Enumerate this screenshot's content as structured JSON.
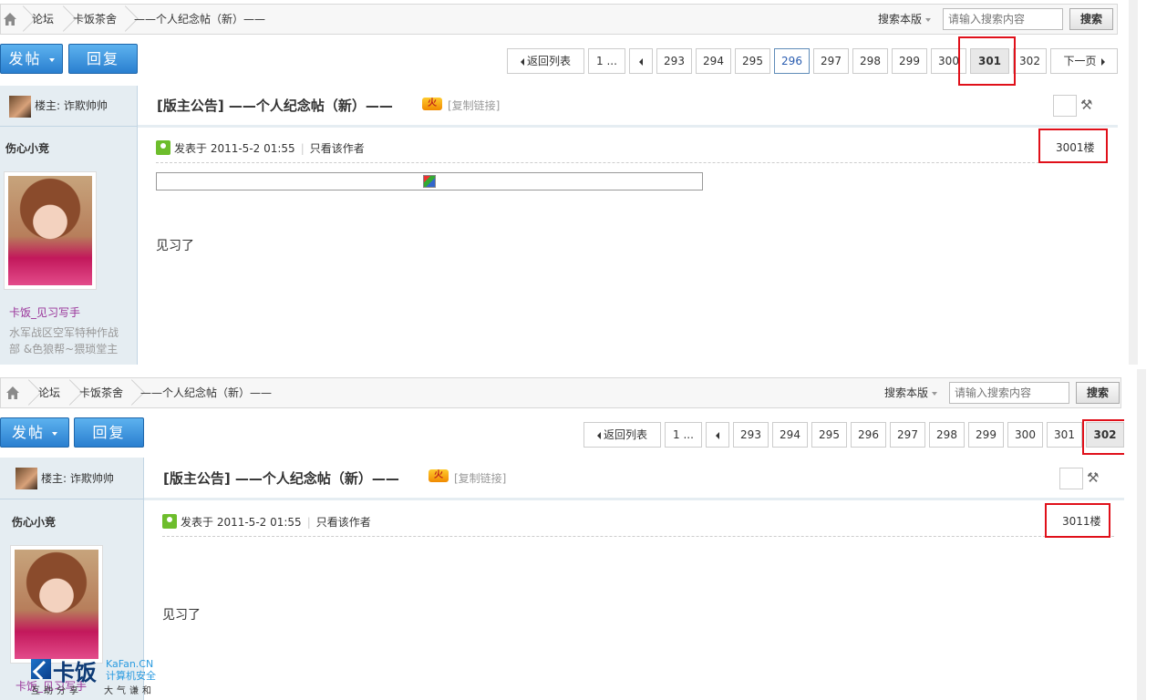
{
  "breadcrumb": {
    "forum": "论坛",
    "board": "卡饭茶舍",
    "thread": "——个人纪念帖（新）——"
  },
  "search": {
    "scope_label": "搜索本版",
    "placeholder": "请输入搜索内容",
    "button_label": "搜索"
  },
  "actions": {
    "new_post": "发帖",
    "reply": "回复"
  },
  "pagination_top": {
    "back": "返回列表",
    "first": "1 ...",
    "pages": [
      "293",
      "294",
      "295",
      "296",
      "297",
      "298",
      "299",
      "300",
      "301",
      "302"
    ],
    "next": "下一页",
    "current": "301"
  },
  "pagination_bottom": {
    "back": "返回列表",
    "first": "1 ...",
    "pages": [
      "293",
      "294",
      "295",
      "296",
      "297",
      "298",
      "299",
      "300",
      "301",
      "302"
    ],
    "current": "302"
  },
  "thread": {
    "author_label": "楼主: 诈欺帅帅",
    "title": "[版主公告] ——个人纪念帖（新）——",
    "fire_badge": "火",
    "copy_link": "[复制链接]"
  },
  "post1": {
    "username": "伤心小竞",
    "rank": "卡饭_见习写手",
    "medal_line1": "水军战区空军特种作战",
    "medal_line2": "部 &色狼帮~猥琐堂主",
    "posted": "发表于 2011-5-2 01:55",
    "only_author": "只看该作者",
    "floor": "3001楼",
    "content": "见习了"
  },
  "post2": {
    "username": "伤心小竞",
    "rank": "卡饭_见习写手",
    "posted": "发表于 2011-5-2 01:55",
    "only_author": "只看该作者",
    "floor": "3011楼",
    "content": "见习了"
  },
  "watermark": {
    "brand": "卡饭",
    "site": "KaFan.CN",
    "subtitle": "计算机安全",
    "slogan_left": "互助分享",
    "slogan_right": "大气谦和"
  },
  "colors": {
    "accent_blue": "#2a7fd0",
    "highlight_red": "#e0101a",
    "sidebar_bg": "#e5edf2",
    "rank_purple": "#993399"
  }
}
